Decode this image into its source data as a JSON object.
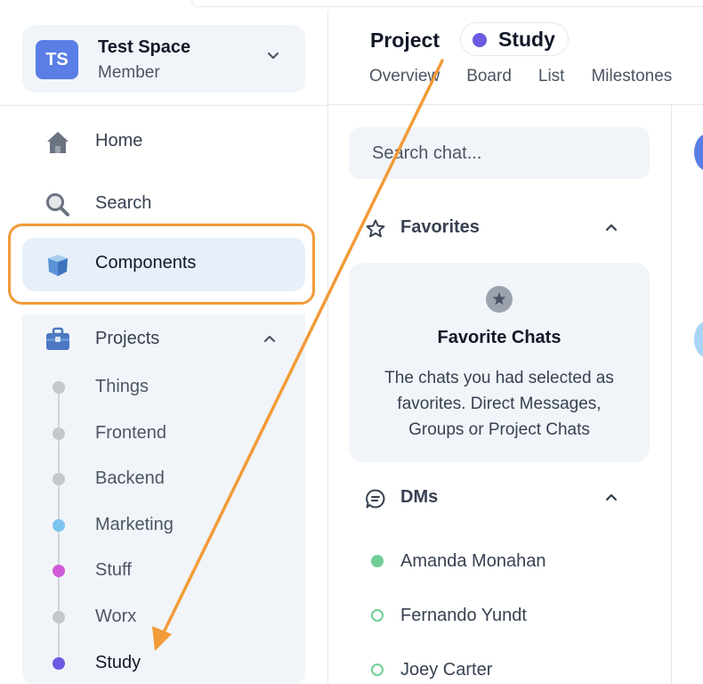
{
  "space": {
    "initials": "TS",
    "name": "Test Space",
    "role": "Member"
  },
  "nav": {
    "home": "Home",
    "search": "Search",
    "components": "Components",
    "projects": "Projects"
  },
  "projects": [
    {
      "name": "Things",
      "color": "#c4c7cc"
    },
    {
      "name": "Frontend",
      "color": "#c4c7cc"
    },
    {
      "name": "Backend",
      "color": "#c4c7cc"
    },
    {
      "name": "Marketing",
      "color": "#7cc4ee"
    },
    {
      "name": "Stuff",
      "color": "#d05ad8"
    },
    {
      "name": "Worx",
      "color": "#c4c7cc"
    },
    {
      "name": "Study",
      "color": "#6a5be0"
    }
  ],
  "header": {
    "label": "Project",
    "project": "Study",
    "project_color": "#6a5be0",
    "tabs": [
      "Overview",
      "Board",
      "List",
      "Milestones"
    ]
  },
  "chat": {
    "search_placeholder": "Search chat...",
    "favorites_label": "Favorites",
    "favorites_title": "Favorite Chats",
    "favorites_desc": "The chats you had selected as favorites. Direct Messages, Groups or Project Chats",
    "dms_label": "DMs",
    "dms": [
      {
        "name": "Amanda Monahan",
        "status": "online"
      },
      {
        "name": "Fernando Yundt",
        "status": "offline"
      },
      {
        "name": "Joey Carter",
        "status": "offline"
      }
    ]
  },
  "colors": {
    "accent": "#5a7ee6",
    "annotation": "#f29b38",
    "active_bg": "#e6effa"
  }
}
